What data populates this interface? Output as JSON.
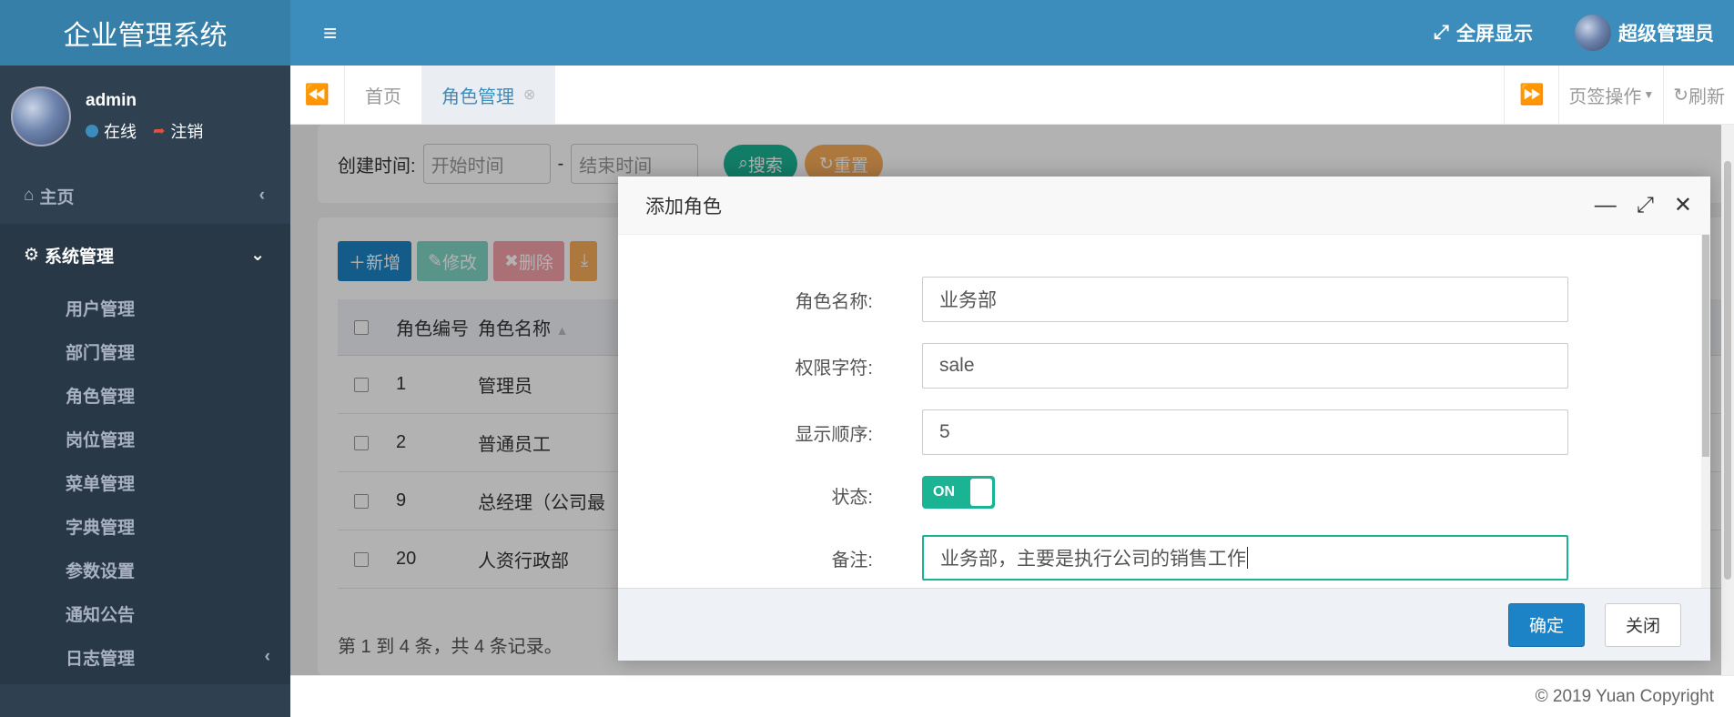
{
  "app": {
    "title": "企业管理系统"
  },
  "user": {
    "name": "admin",
    "status": "在线",
    "logout": "注销"
  },
  "sidebar": {
    "home": "主页",
    "system": "系统管理",
    "items": [
      "用户管理",
      "部门管理",
      "角色管理",
      "岗位管理",
      "菜单管理",
      "字典管理",
      "参数设置",
      "通知公告",
      "日志管理"
    ]
  },
  "topbar": {
    "fullscreen": "全屏显示",
    "admin": "超级管理员"
  },
  "tabs": {
    "home": "首页",
    "role": "角色管理",
    "ops": "页签操作",
    "refresh": "刷新"
  },
  "search": {
    "label": "创建时间:",
    "start_placeholder": "开始时间",
    "sep": "-",
    "end_placeholder": "结束时间",
    "search_btn": "搜索",
    "reset_btn": "重置"
  },
  "toolbar": {
    "add": "新增",
    "edit": "修改",
    "delete": "删除"
  },
  "table": {
    "headers": [
      "角色编号",
      "角色名称"
    ],
    "rows": [
      [
        "1",
        "管理员"
      ],
      [
        "2",
        "普通员工"
      ],
      [
        "9",
        "总经理（公司最"
      ],
      [
        "20",
        "人资行政部"
      ]
    ],
    "pager": "第 1 到 4 条，共 4 条记录。"
  },
  "modal": {
    "title": "添加角色",
    "fields": {
      "name_label": "角色名称:",
      "name_value": "业务部",
      "key_label": "权限字符:",
      "key_value": "sale",
      "order_label": "显示顺序:",
      "order_value": "5",
      "status_label": "状态:",
      "status_value": "ON",
      "remark_label": "备注:",
      "remark_value": "业务部，主要是执行公司的销售工作"
    },
    "confirm": "确定",
    "close": "关闭"
  },
  "footer": {
    "copyright": "© 2019 Yuan Copyright"
  },
  "colors": {
    "sidebar": "#2f4050",
    "header": "#3c8dbc",
    "success": "#1ab394",
    "primary": "#1c84c6"
  }
}
